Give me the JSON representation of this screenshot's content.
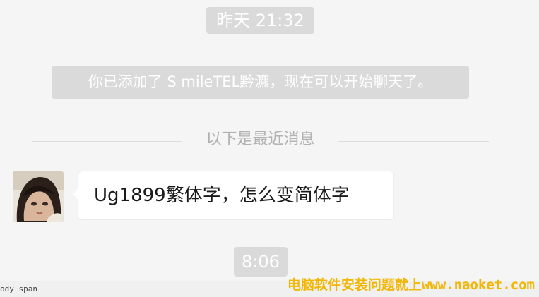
{
  "chat": {
    "time_top": "昨天 21:32",
    "system_message": "你已添加了 S mileTEL黔瀌，现在可以开始聊天了。",
    "divider_text": "以下是最近消息",
    "messages": [
      {
        "sender": "contact",
        "text": "Ug1899繁体字，怎么变简体字"
      }
    ],
    "time_bottom": "8:06"
  },
  "status_bar": {
    "path": "ody  span"
  },
  "watermark": {
    "text": "电脑软件安装问题就上www.naoket.com",
    "color": "#f2b705"
  }
}
